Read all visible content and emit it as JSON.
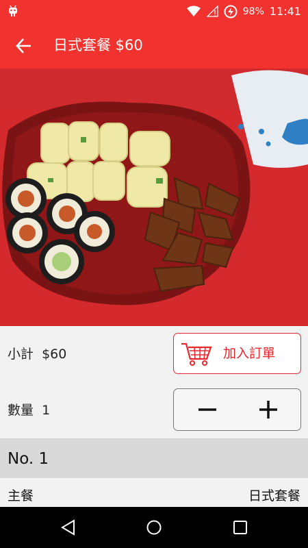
{
  "status_bar": {
    "battery": "98%",
    "time": "11:41"
  },
  "app_bar": {
    "title": "日式套餐 $60"
  },
  "order": {
    "subtotal_label": "小計",
    "subtotal_value": "$60",
    "add_to_order": "加入訂單",
    "quantity_label": "數量",
    "quantity_value": "1"
  },
  "details": {
    "header": "No. 1",
    "items": [
      {
        "key": "主餐",
        "value": "日式套餐"
      }
    ]
  },
  "colors": {
    "primary": "#f2322e",
    "accent": "#e9262c"
  }
}
